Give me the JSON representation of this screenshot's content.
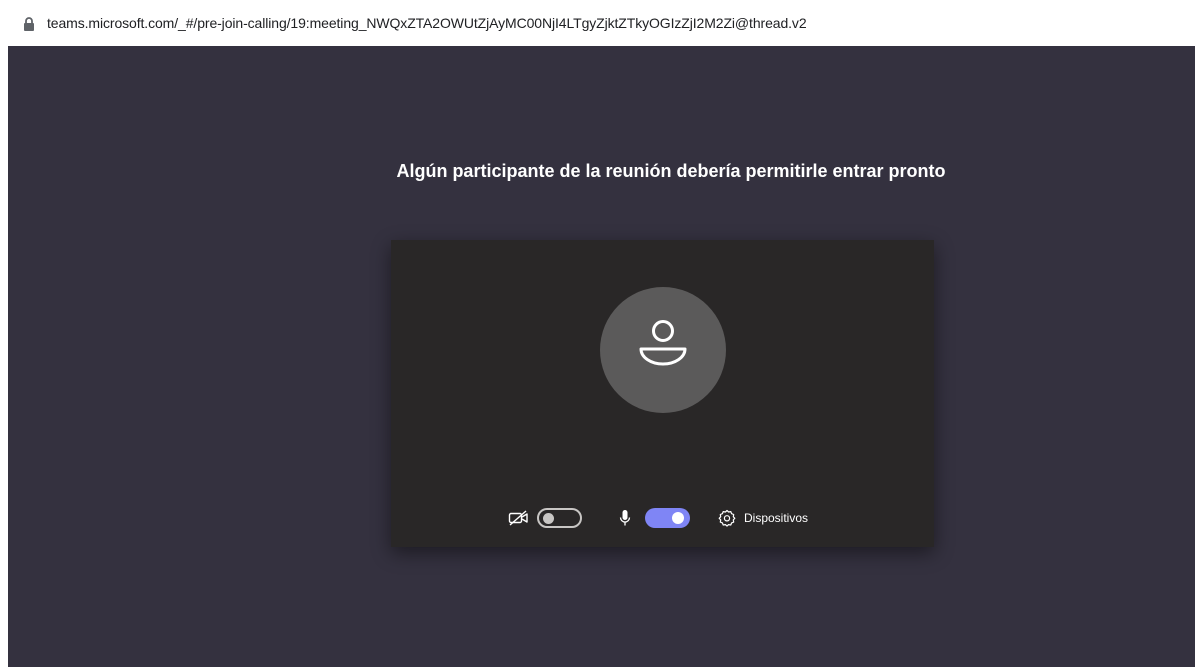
{
  "browser": {
    "url": "teams.microsoft.com/_#/pre-join-calling/19:meeting_NWQxZTA2OWUtZjAyMC00NjI4LTgyZjktZTkyOGIzZjI2M2Zi@thread.v2",
    "lock_icon": "lock-icon"
  },
  "lobby": {
    "message": "Algún participante de la reunión debería permitirle entrar pronto",
    "avatar_icon": "person-icon",
    "camera": {
      "icon": "camera-off-icon",
      "enabled": false
    },
    "microphone": {
      "icon": "microphone-icon",
      "enabled": true
    },
    "devices_label": "Dispositivos",
    "devices_icon": "gear-icon"
  },
  "colors": {
    "stage_background": "#34313f",
    "preview_background": "#292727",
    "avatar_background": "#5b5a5a",
    "toggle_on": "#7f85f5",
    "toggle_off": "#c8c6c4",
    "text": "#ffffff"
  }
}
